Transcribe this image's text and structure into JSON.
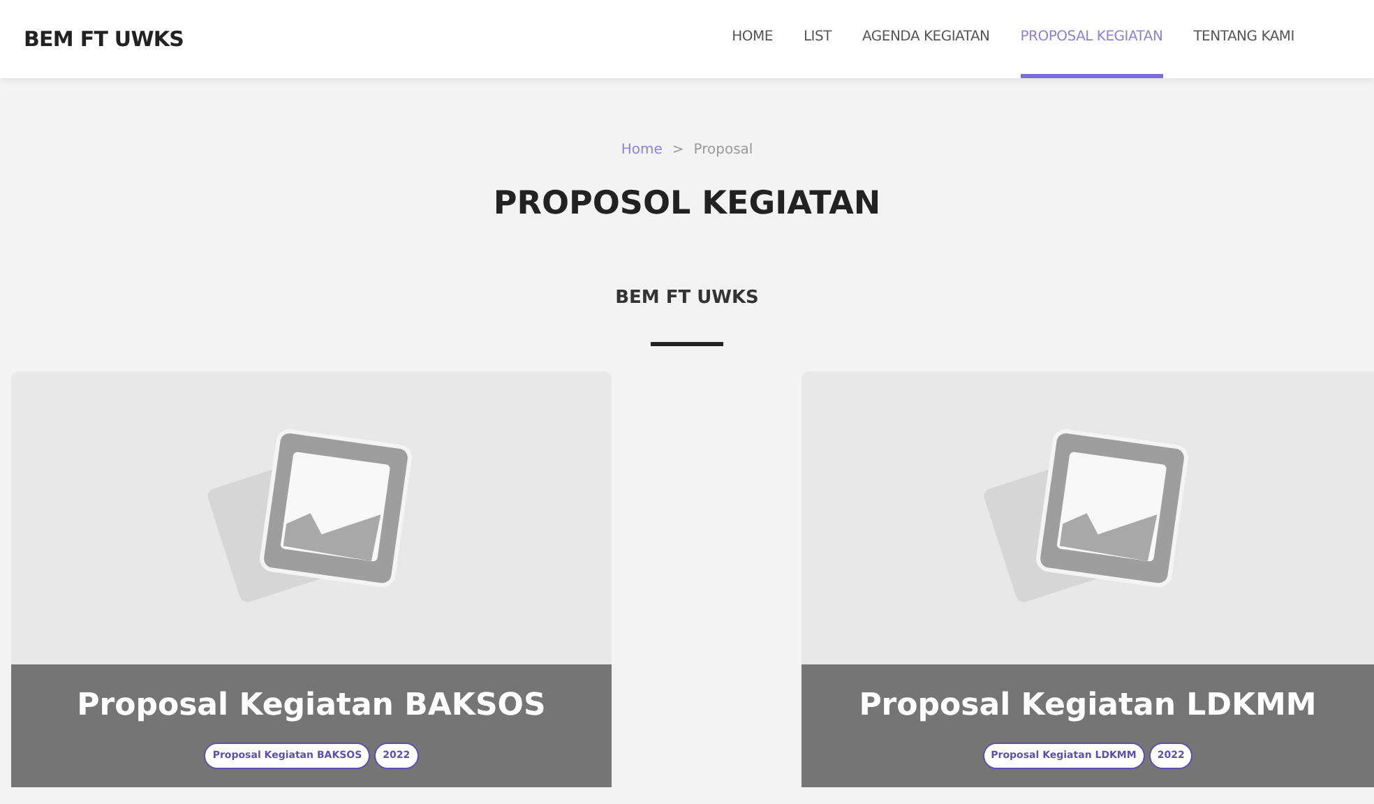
{
  "brand": "BEM FT UWKS",
  "nav": [
    {
      "label": "HOME",
      "selected": false
    },
    {
      "label": "LIST",
      "selected": false
    },
    {
      "label": "AGENDA KEGIATAN",
      "selected": false
    },
    {
      "label": "PROPOSAL KEGIATAN",
      "selected": true
    },
    {
      "label": "TENTANG KAMI",
      "selected": false
    }
  ],
  "breadcrumb": [
    {
      "label": "Home",
      "link": true
    },
    {
      "label": ">",
      "link": false
    },
    {
      "label": "Proposal",
      "link": false
    }
  ],
  "page_title": "PROPOSOL KEGIATAN",
  "subtitle": "BEM FT UWKS",
  "cards": [
    {
      "title": "Proposal Kegiatan BAKSOS",
      "tags": [
        "Proposal Kegiatan BAKSOS",
        "2022"
      ]
    },
    {
      "title": "Proposal Kegiatan LDKMM",
      "tags": [
        "Proposal Kegiatan LDKMM",
        "2022"
      ]
    }
  ]
}
